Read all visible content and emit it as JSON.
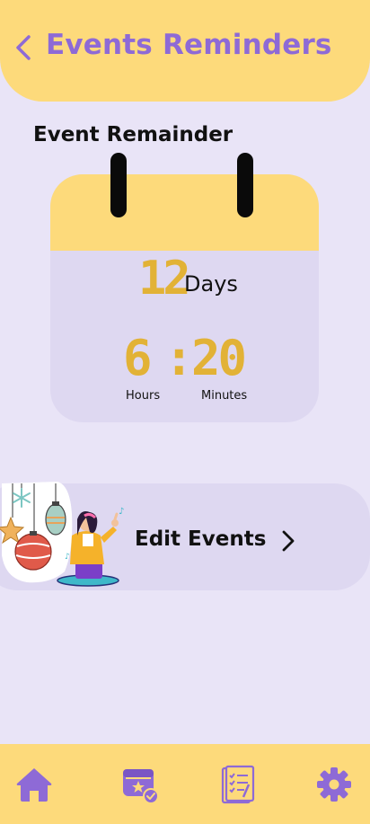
{
  "header": {
    "title": "Events Reminders",
    "back_icon": "chevron-left-icon"
  },
  "section": {
    "title": "Event Remainder"
  },
  "countdown": {
    "days_value": "12",
    "days_label": "Days",
    "hours_value": "6",
    "separator": ":",
    "minutes_value": "20",
    "hours_label": "Hours",
    "minutes_label": "Minutes"
  },
  "edit_card": {
    "label": "Edit Events",
    "arrow_icon": "chevron-right-icon",
    "illustration": "celebration-illustration"
  },
  "bottom_nav": {
    "items": [
      {
        "icon": "home-icon",
        "active": true
      },
      {
        "icon": "event-calendar-icon",
        "active": false
      },
      {
        "icon": "checklist-icon",
        "active": false
      },
      {
        "icon": "gear-icon",
        "active": false
      }
    ]
  },
  "colors": {
    "background": "#e9e4f7",
    "accent_yellow": "#fdda7b",
    "title_purple": "#8e6ad6",
    "number_gold": "#e2b236",
    "card_lavender": "#ded8f1"
  }
}
